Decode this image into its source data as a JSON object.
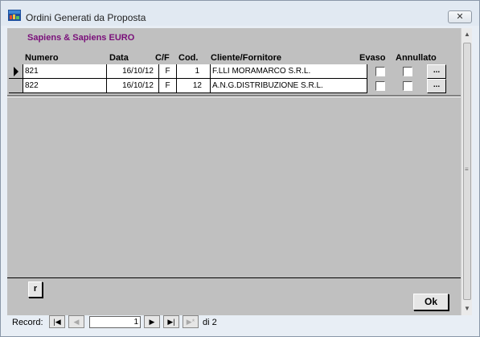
{
  "window": {
    "title": "Ordini Generati da Proposta",
    "close_label": "✕"
  },
  "company": "Sapiens & Sapiens EURO",
  "table": {
    "headers": {
      "numero": "Numero",
      "data": "Data",
      "cf": "C/F",
      "cod": "Cod.",
      "cliente": "Cliente/Fornitore",
      "evaso": "Evaso",
      "annullato": "Annullato"
    },
    "rows": [
      {
        "numero": "821",
        "data": "16/10/12",
        "cf": "F",
        "cod": "1",
        "cliente": "F.LLI MORAMARCO S.R.L.",
        "evaso": false,
        "annullato": false,
        "dots": "..."
      },
      {
        "numero": "822",
        "data": "16/10/12",
        "cf": "F",
        "cod": "12",
        "cliente": "A.N.G.DISTRIBUZIONE S.R.L.",
        "evaso": false,
        "annullato": false,
        "dots": "..."
      }
    ]
  },
  "buttons": {
    "r_label": "r",
    "ok_label": "Ok"
  },
  "navigator": {
    "label": "Record:",
    "current": "1",
    "of_text": "di 2",
    "first_icon": "first-record-icon",
    "prev_icon": "prev-record-icon",
    "next_icon": "next-record-icon",
    "last_icon": "last-record-icon",
    "new_icon": "new-record-icon"
  }
}
